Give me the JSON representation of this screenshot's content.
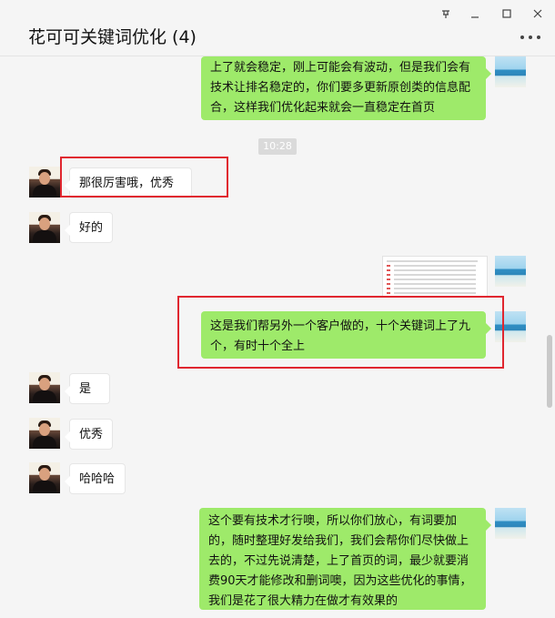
{
  "window": {
    "title": "花可可关键词优化 (4)",
    "pin_icon": "pin-icon",
    "minimize_icon": "minimize-icon",
    "maximize_icon": "maximize-icon",
    "close_icon": "close-icon",
    "more_icon": "more-dots-icon"
  },
  "messages": {
    "m1": "上了就会稳定，刚上可能会有波动，但是我们会有技术让排名稳定的，你们要多更新原创类的信息配合，这样我们优化起来就会一直稳定在首页",
    "timestamp": "10:28",
    "m2": "那很厉害哦，优秀",
    "m3": "好的",
    "m4": "这是我们帮另外一个客户做的，十个关键词上了九个，有时十个全上",
    "m5": "是",
    "m6": "优秀",
    "m7": "哈哈哈",
    "m8": "这个要有技术才行噢，所以你们放心，有词要加的，随时整理好发给我们，我们会帮你们尽快做上去的，不过先说清楚，上了首页的词，最少就要消费90天才能修改和删词噢，因为这些优化的事情，我们是花了很大精力在做才有效果的"
  },
  "colors": {
    "bubble_self": "#9eea6a",
    "bubble_other": "#ffffff",
    "highlight_box": "#e0262f",
    "background": "#f5f5f5"
  }
}
